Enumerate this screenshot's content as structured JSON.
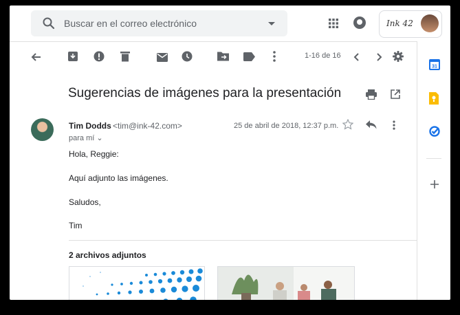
{
  "search": {
    "placeholder": "Buscar en el correo electrónico"
  },
  "account": {
    "logo_text": "Ink 42"
  },
  "toolbar": {
    "range": "1-16 de 16"
  },
  "message": {
    "subject": "Sugerencias de imágenes para la presentación",
    "sender_name": "Tim Dodds",
    "sender_email": "<tim@ink-42.com>",
    "to_label": "para mí",
    "date": "25 de abril de 2018, 12:37 p.m.",
    "body": [
      "Hola, Reggie:",
      "Aquí adjunto las imágenes.",
      "Saludos,",
      "Tim"
    ]
  },
  "attachments": {
    "title": "2 archivos adjuntos"
  },
  "colors": {
    "accent": "#1a73e8",
    "icon": "#5f6368",
    "keep_yellow": "#fbbc04"
  }
}
